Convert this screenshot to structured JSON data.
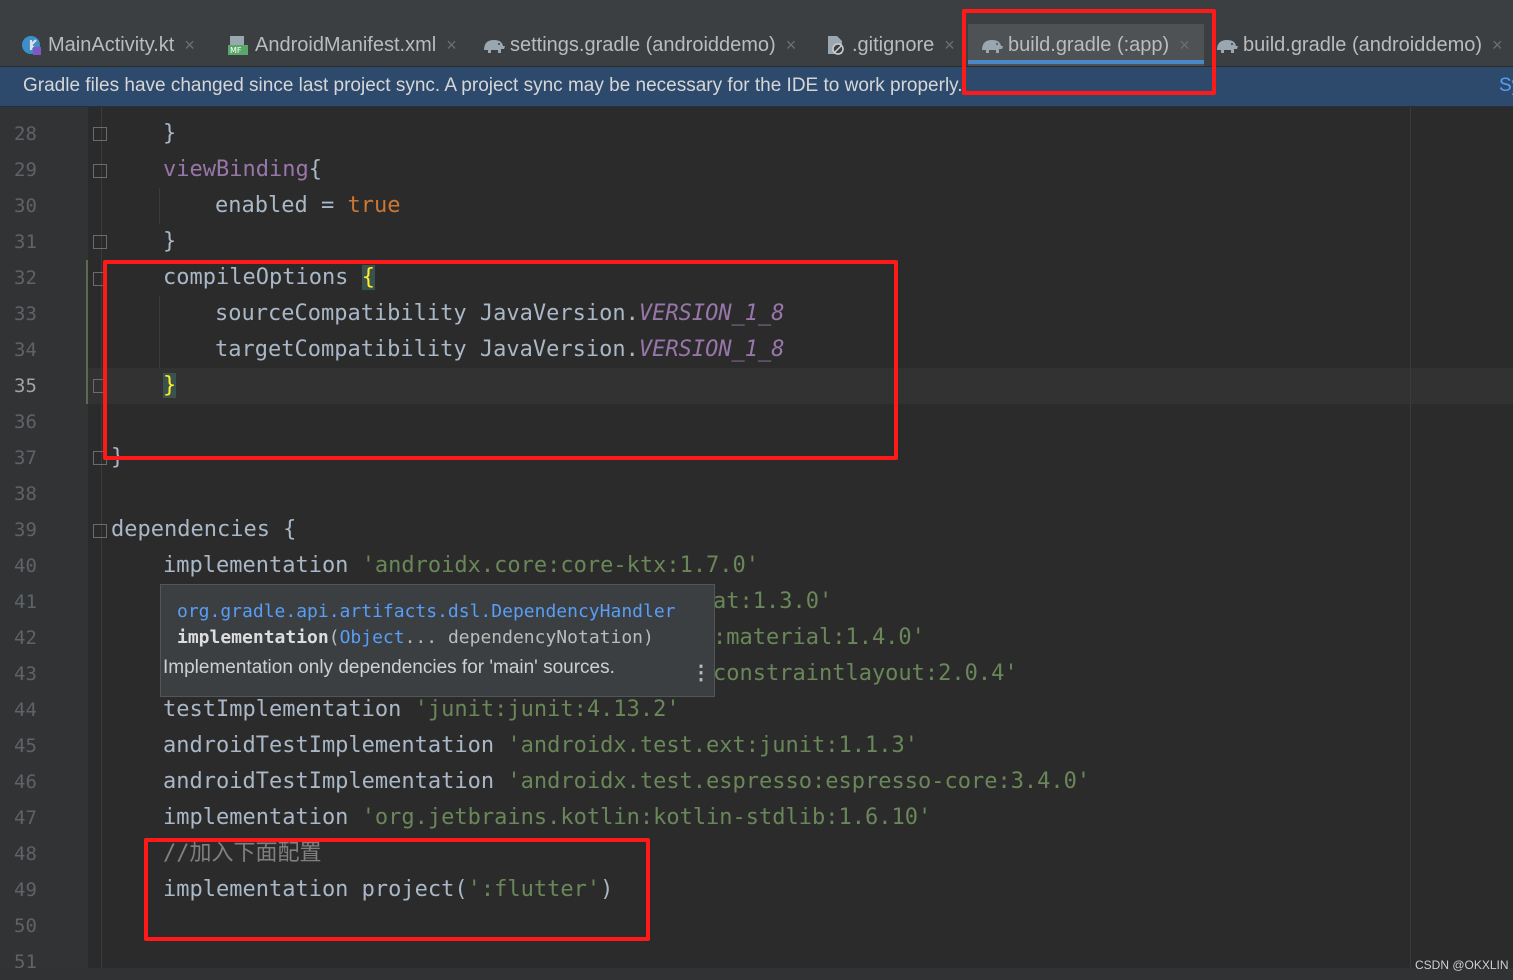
{
  "tabs": [
    {
      "label": "MainActivity.kt",
      "icon": "kotlin-class-icon",
      "close": "×",
      "active": false
    },
    {
      "label": "AndroidManifest.xml",
      "icon": "manifest-icon",
      "close": "×",
      "active": false
    },
    {
      "label": "settings.gradle (androiddemo)",
      "icon": "gradle-elephant-icon",
      "close": "×",
      "active": false
    },
    {
      "label": ".gitignore",
      "icon": "ignore-file-icon",
      "close": "×",
      "active": false
    },
    {
      "label": "build.gradle (:app)",
      "icon": "gradle-elephant-icon",
      "close": "×",
      "active": true
    },
    {
      "label": "build.gradle (androiddemo)",
      "icon": "gradle-elephant-icon",
      "close": "×",
      "active": false
    }
  ],
  "notification": {
    "text": "Gradle files have changed since last project sync. A project sync may be necessary for the IDE to work properly.",
    "action": "Sy"
  },
  "line_numbers": [
    "28",
    "29",
    "30",
    "31",
    "32",
    "33",
    "34",
    "35",
    "36",
    "37",
    "38",
    "39",
    "40",
    "41",
    "42",
    "43",
    "44",
    "45",
    "46",
    "47",
    "48",
    "49",
    "50",
    "51"
  ],
  "current_line": "35",
  "code": {
    "l28": "}",
    "l29_a": "viewBinding",
    "l29_b": "{",
    "l30_a": "enabled = ",
    "l30_b": "true",
    "l31": "}",
    "l32_a": "compileOptions ",
    "l32_b": "{",
    "l33_a": "sourceCompatibility JavaVersion.",
    "l33_b": "VERSION_1_8",
    "l34_a": "targetCompatibility JavaVersion.",
    "l34_b": "VERSION_1_8",
    "l35": "}",
    "l37": "}",
    "l39": "dependencies {",
    "l40_a": "implementation ",
    "l40_b": "'androidx.core:core-ktx:1.7.0'",
    "l41_tail": "at:1.3.0'",
    "l42_tail": ":material:1.4.0'",
    "l43_tail": "constraintlayout:2.0.4'",
    "l44_a": "testImplementation ",
    "l44_b": "'junit:junit:4.13.2'",
    "l45_a": "androidTestImplementation ",
    "l45_b": "'androidx.test.ext:junit:1.1.3'",
    "l46_a": "androidTestImplementation ",
    "l46_b": "'androidx.test.espresso:espresso-core:3.4.0'",
    "l47_a": "implementation ",
    "l47_b": "'org.jetbrains.kotlin:kotlin-stdlib:1.6.10'",
    "l48": "//加入下面配置",
    "l49_a": "implementation project(",
    "l49_b": "':flutter'",
    "l49_c": ")"
  },
  "popup": {
    "class_name": "org.gradle.api.artifacts.dsl.DependencyHandler",
    "method": "implementation",
    "param_open": "(",
    "param_type": "Object",
    "param_rest": "... dependencyNotation)",
    "doc": "Implementation only dependencies for 'main' sources.",
    "more": "⋮"
  },
  "watermark": "CSDN @OKXLIN",
  "colors": {
    "highlight_box": "#ff1a1a",
    "notification_bg": "#2d4a6d",
    "active_tab_underline": "#4a88c7"
  }
}
